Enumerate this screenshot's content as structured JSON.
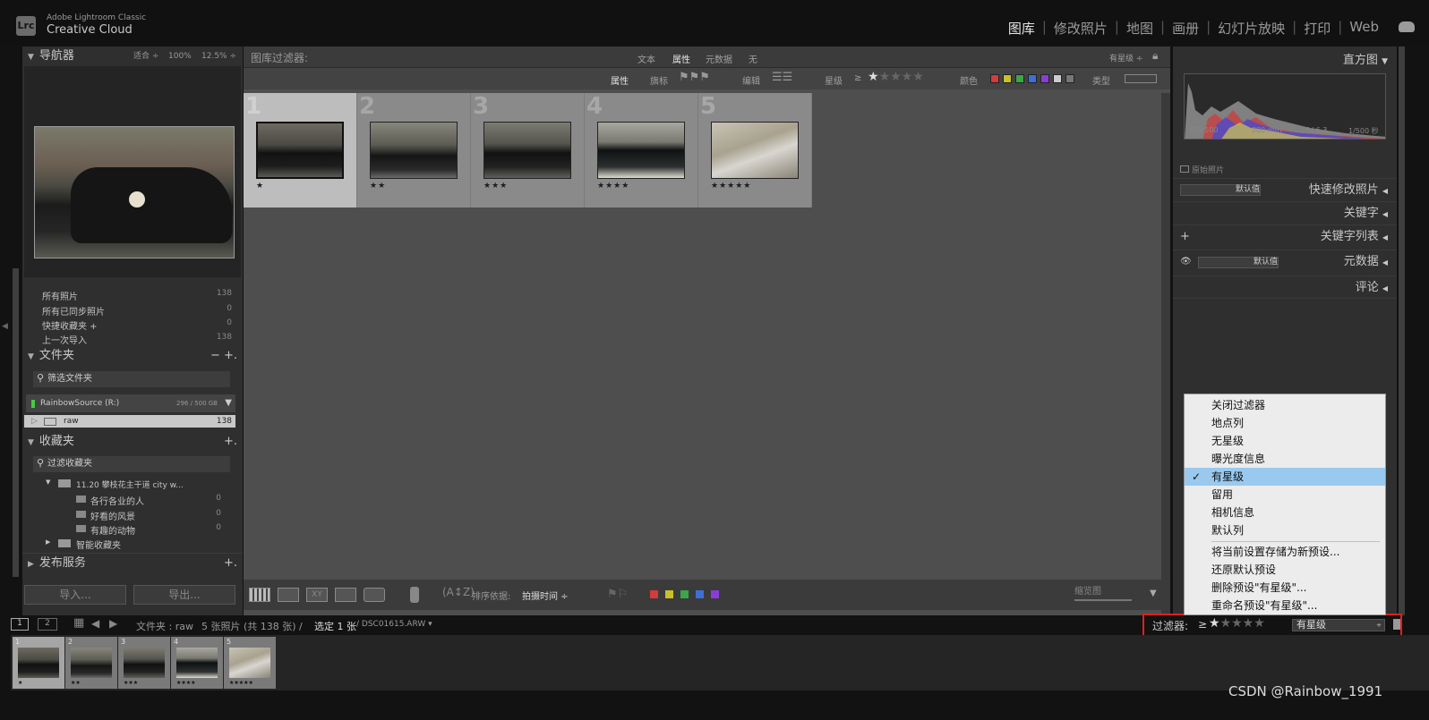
{
  "app": {
    "logo": "Lrc",
    "line1": "Adobe Lightroom Classic",
    "line2": "Creative Cloud"
  },
  "modules": [
    {
      "label": "图库",
      "active": true
    },
    {
      "label": "修改照片"
    },
    {
      "label": "地图"
    },
    {
      "label": "画册"
    },
    {
      "label": "幻灯片放映"
    },
    {
      "label": "打印"
    },
    {
      "label": "Web"
    }
  ],
  "navigator": {
    "title": "导航器",
    "fit": "适合 ÷",
    "z100": "100%",
    "z125": "12.5% ÷"
  },
  "catalog": {
    "rows": [
      {
        "label": "所有照片",
        "count": "138"
      },
      {
        "label": "所有已同步照片",
        "count": "0"
      },
      {
        "label": "快捷收藏夹 +",
        "count": "0"
      },
      {
        "label": "上一次导入",
        "count": "138"
      }
    ]
  },
  "folders": {
    "title": "文件夹",
    "actions": "− +.",
    "search": "筛选文件夹",
    "volume": "RainbowSource (R:)",
    "volume_size": "296 / 500 GB",
    "folder": "raw",
    "folder_count": "138"
  },
  "collections": {
    "title": "收藏夹",
    "action": "+.",
    "search": "过滤收藏夹",
    "set": "11.20 攀枝花主干道 city w...",
    "items": [
      {
        "label": "各行各业的人",
        "count": "0"
      },
      {
        "label": "好看的风景",
        "count": "0"
      },
      {
        "label": "有趣的动物",
        "count": "0"
      }
    ],
    "smart": "智能收藏夹"
  },
  "publish": {
    "title": "发布服务",
    "action": "+."
  },
  "buttons": {
    "import": "导入...",
    "export": "导出..."
  },
  "filterbar": {
    "title": "图库过滤器:",
    "tabs": [
      "文本",
      "属性",
      "元数据",
      "无"
    ],
    "active_tab": "属性",
    "preset": "有星级 ÷"
  },
  "attrbar": {
    "attr": "属性",
    "flag": "旗标",
    "edit": "编辑",
    "rating": "星级",
    "gte": "≥",
    "color": "颜色",
    "type": "类型"
  },
  "grid": [
    {
      "num": "1",
      "stars": "★"
    },
    {
      "num": "2",
      "stars": "★★"
    },
    {
      "num": "3",
      "stars": "★★★"
    },
    {
      "num": "4",
      "stars": "★★★★"
    },
    {
      "num": "5",
      "stars": "★★★★★"
    }
  ],
  "toolbar": {
    "sort_label": "排序依据:",
    "sort_value": "拍摄时间 ÷",
    "thumb_label": "缩览图"
  },
  "histogram": {
    "title": "直方图",
    "iso": "ISO 500",
    "focal": "200 mm",
    "aperture": "f / 6.3",
    "shutter": "1/500 秒",
    "original": "原始照片"
  },
  "right": {
    "preset": "默认值",
    "quick": "快速修改照片",
    "keywording": "关键字",
    "keyword_list": "关键字列表",
    "metadata_preset": "默认值",
    "metadata": "元数据",
    "comments": "评论"
  },
  "status": {
    "p1": "1",
    "p2": "2",
    "path": "文件夹 : raw",
    "count": "5 张照片 (共 138 张) /",
    "selected": "选定 1 张",
    "file": "/ DSC01615.ARW ▾",
    "filter_label": "过滤器:",
    "filter_gte": "≥",
    "filter_stars": "★★★★★",
    "filter_value": "有星级"
  },
  "menu": {
    "items": [
      "关闭过滤器",
      "地点列",
      "无星级",
      "曝光度信息",
      "有星级",
      "留用",
      "相机信息",
      "默认列"
    ],
    "checked": "有星级",
    "items2": [
      "将当前设置存储为新预设...",
      "还原默认预设",
      "删除预设\"有星级\"...",
      "重命名预设\"有星级\"..."
    ]
  },
  "filmstrip": [
    {
      "num": "1",
      "stars": "★"
    },
    {
      "num": "2",
      "stars": "★★"
    },
    {
      "num": "3",
      "stars": "★★★"
    },
    {
      "num": "4",
      "stars": "★★★★"
    },
    {
      "num": "5",
      "stars": "★★★★★"
    }
  ],
  "watermark": "CSDN @Rainbow_1991",
  "colors": {
    "highlight": "#99c9ef",
    "annotation": "#e02020",
    "red": "#d43b3b",
    "yellow": "#c9c02a",
    "green": "#3aa64a",
    "blue": "#3d6fd6",
    "purple": "#8a3dd6"
  }
}
